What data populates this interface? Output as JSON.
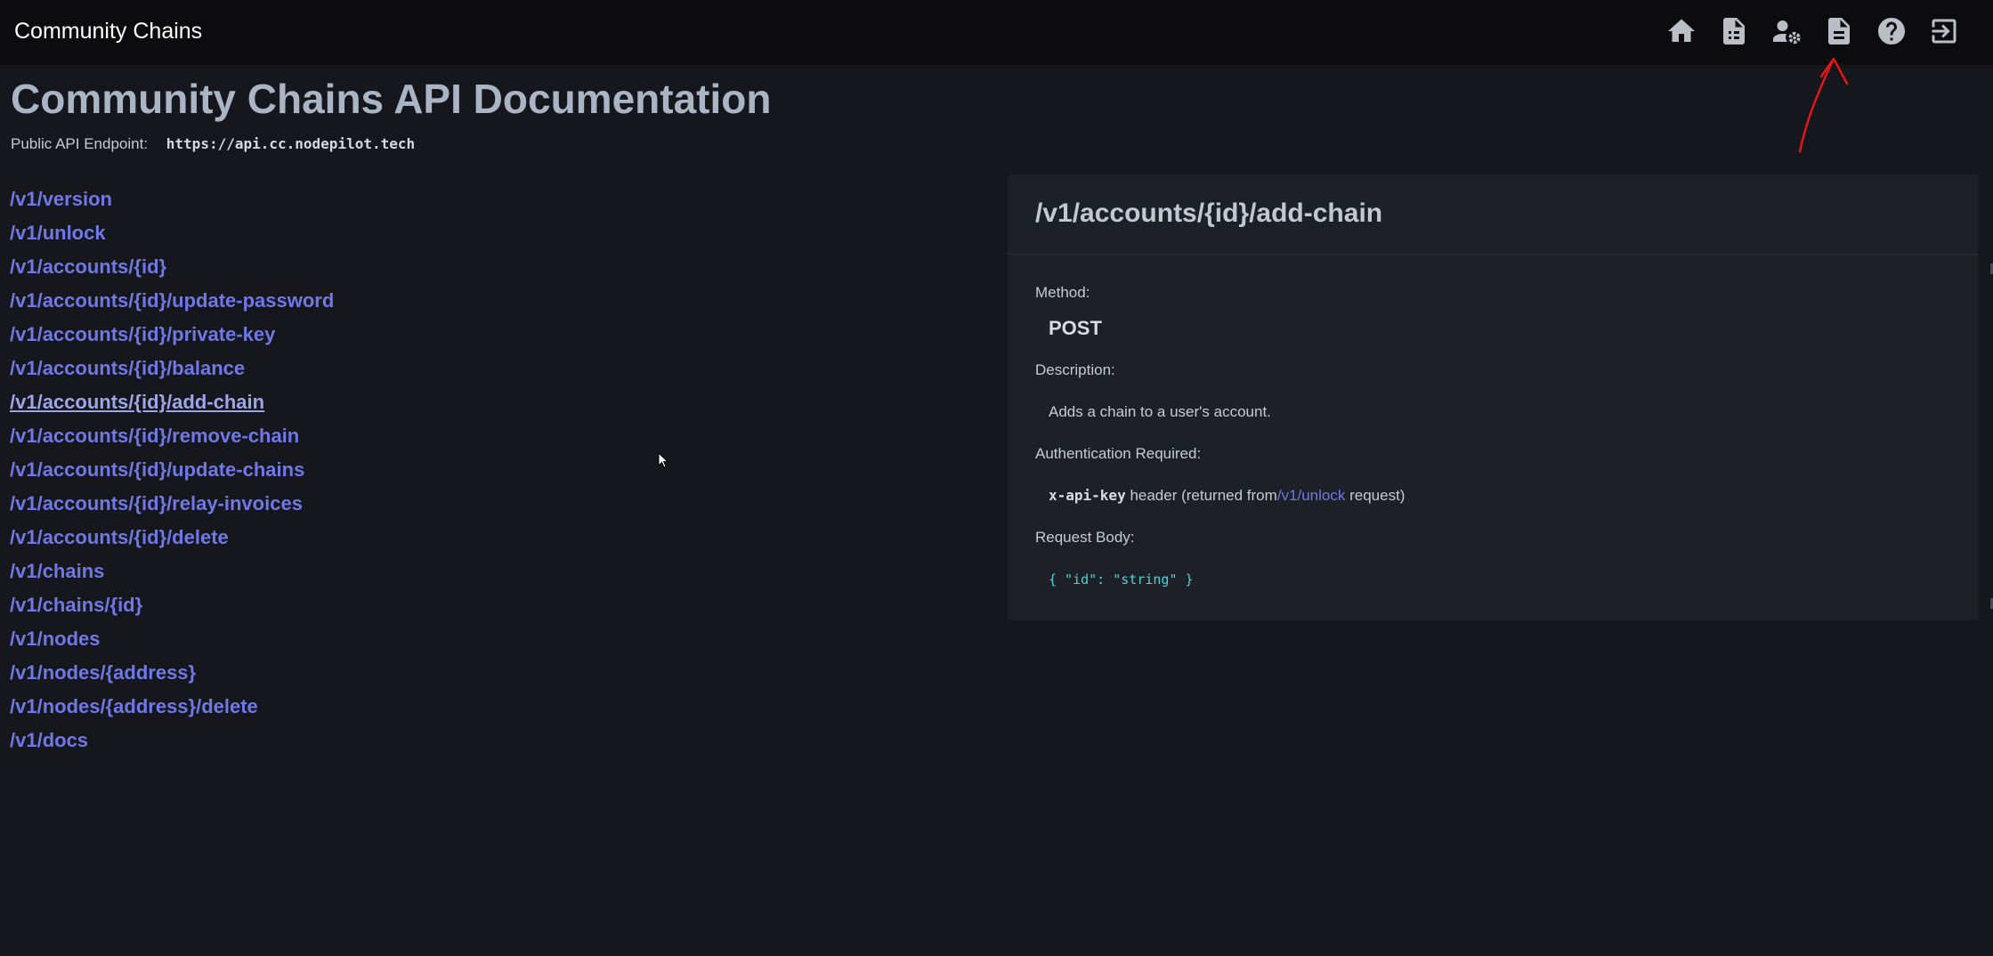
{
  "app": {
    "title": "Community Chains"
  },
  "nav": {
    "icons": [
      {
        "name": "home-icon",
        "label": "Home"
      },
      {
        "name": "document-list-icon",
        "label": "Invoices"
      },
      {
        "name": "user-settings-icon",
        "label": "Account Settings"
      },
      {
        "name": "docs-icon",
        "label": "API Docs"
      },
      {
        "name": "help-icon",
        "label": "Help"
      },
      {
        "name": "logout-icon",
        "label": "Logout"
      }
    ]
  },
  "page": {
    "title": "Community Chains API Documentation",
    "endpoint_label": "Public API Endpoint:",
    "endpoint_url": "https://api.cc.nodepilot.tech"
  },
  "routes": [
    "/v1/version",
    "/v1/unlock",
    "/v1/accounts/{id}",
    "/v1/accounts/{id}/update-password",
    "/v1/accounts/{id}/private-key",
    "/v1/accounts/{id}/balance",
    "/v1/accounts/{id}/add-chain",
    "/v1/accounts/{id}/remove-chain",
    "/v1/accounts/{id}/update-chains",
    "/v1/accounts/{id}/relay-invoices",
    "/v1/accounts/{id}/delete",
    "/v1/chains",
    "/v1/chains/{id}",
    "/v1/nodes",
    "/v1/nodes/{address}",
    "/v1/nodes/{address}/delete",
    "/v1/docs"
  ],
  "active_route_index": 6,
  "detail": {
    "title": "/v1/accounts/{id}/add-chain",
    "method_label": "Method:",
    "method": "POST",
    "description_label": "Description:",
    "description": "Adds a chain to a user's account.",
    "auth_label": "Authentication Required:",
    "auth_key": "x-api-key",
    "auth_text_before": "header (returned from",
    "auth_link": "/v1/unlock",
    "auth_text_after": "request)",
    "body_label": "Request Body:",
    "body": "{ \"id\": \"string\" }"
  },
  "colors": {
    "background": "#16171c",
    "navbar": "#0c0c0e",
    "link": "#6f78e6",
    "card": "#1e2027",
    "title": "#a9b4c4",
    "code": "#4fd1d9",
    "annotation": "#e8161a"
  }
}
